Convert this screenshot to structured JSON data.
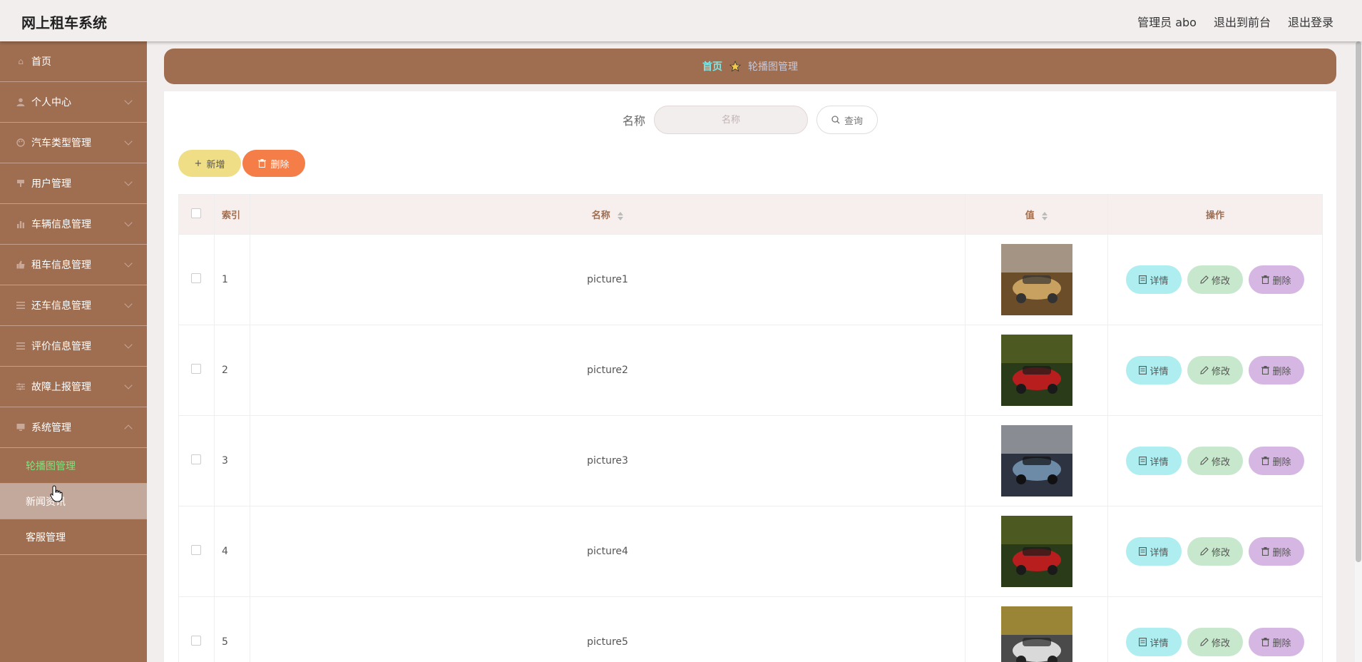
{
  "header": {
    "app_title": "网上租车系统",
    "admin_label": "管理员 abo",
    "to_front": "退出到前台",
    "logout": "退出登录"
  },
  "sidebar": {
    "items": [
      {
        "label": "首页",
        "icon": "home-icon"
      },
      {
        "label": "个人中心",
        "icon": "user-icon"
      },
      {
        "label": "汽车类型管理",
        "icon": "palette-icon"
      },
      {
        "label": "用户管理",
        "icon": "brush-icon"
      },
      {
        "label": "车辆信息管理",
        "icon": "bar-chart-icon"
      },
      {
        "label": "租车信息管理",
        "icon": "thumb-icon"
      },
      {
        "label": "还车信息管理",
        "icon": "list-icon"
      },
      {
        "label": "评价信息管理",
        "icon": "list-icon"
      },
      {
        "label": "故障上报管理",
        "icon": "sliders-icon"
      },
      {
        "label": "系统管理",
        "icon": "monitor-icon"
      }
    ],
    "sub_items": [
      {
        "label": "轮播图管理",
        "state": "active"
      },
      {
        "label": "新闻资讯",
        "state": "hover"
      },
      {
        "label": "客服管理",
        "state": "normal"
      }
    ]
  },
  "breadcrumb": {
    "home": "首页",
    "current": "轮播图管理"
  },
  "search": {
    "label": "名称",
    "placeholder": "名称",
    "button": "查询"
  },
  "actions": {
    "add": "新增",
    "delete": "删除"
  },
  "table": {
    "headers": {
      "index": "索引",
      "name": "名称",
      "value": "值",
      "ops": "操作"
    },
    "op_labels": {
      "detail": "详情",
      "edit": "修改",
      "remove": "删除"
    },
    "rows": [
      {
        "index": "1",
        "name": "picture1"
      },
      {
        "index": "2",
        "name": "picture2"
      },
      {
        "index": "3",
        "name": "picture3"
      },
      {
        "index": "4",
        "name": "picture4"
      },
      {
        "index": "5",
        "name": "picture5"
      }
    ]
  },
  "colors": {
    "accent": "#9f6e51",
    "active_sub": "#7fe27c",
    "add_btn": "#efde85",
    "del_btn": "#f57d48"
  }
}
